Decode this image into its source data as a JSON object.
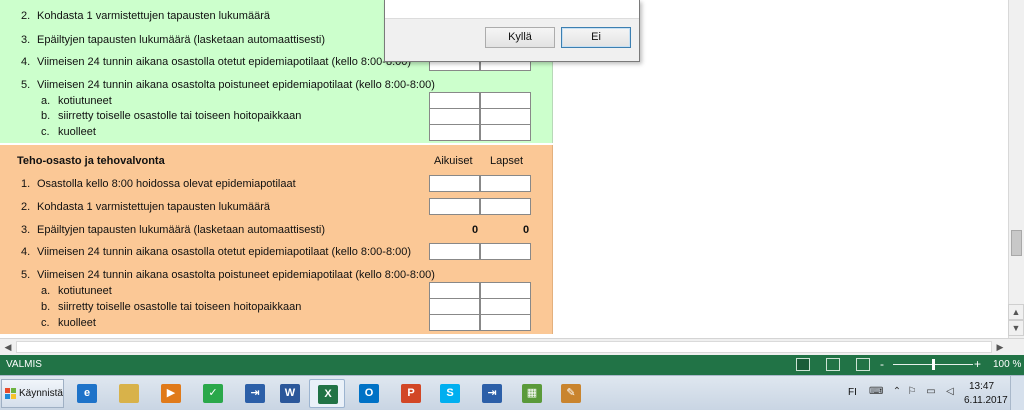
{
  "sheet": {
    "green": {
      "rows": [
        {
          "num": "2.",
          "text": "Kohdasta 1 varmistettujen tapausten lukumäärä"
        },
        {
          "num": "3.",
          "text": "Epäiltyjen tapausten lukumäärä (lasketaan automaattisesti)"
        },
        {
          "num": "4.",
          "text": "Viimeisen 24 tunnin aikana osastolla otetut epidemiapotilaat (kello 8:00-8:00)"
        },
        {
          "num": "5.",
          "text": "Viimeisen 24 tunnin aikana osastolta poistuneet epidemiapotilaat (kello 8:00-8:00)"
        }
      ],
      "sub": [
        {
          "letter": "a.",
          "text": "kotiutuneet"
        },
        {
          "letter": "b.",
          "text": "siirretty toiselle osastolle tai toiseen hoitopaikkaan"
        },
        {
          "letter": "c.",
          "text": "kuolleet"
        }
      ]
    },
    "orange": {
      "title": "Teho-osasto ja tehovalvonta",
      "col_adults": "Aikuiset",
      "col_children": "Lapset",
      "rows": [
        {
          "num": "1.",
          "text": "Osastolla kello 8:00 hoidossa olevat epidemiapotilaat"
        },
        {
          "num": "2.",
          "text": "Kohdasta 1 varmistettujen tapausten lukumäärä"
        },
        {
          "num": "3.",
          "text": "Epäiltyjen tapausten lukumäärä (lasketaan automaattisesti)"
        },
        {
          "num": "4.",
          "text": "Viimeisen 24 tunnin aikana osastolla otetut epidemiapotilaat (kello 8:00-8:00)"
        },
        {
          "num": "5.",
          "text": "Viimeisen 24 tunnin aikana osastolta poistuneet epidemiapotilaat (kello 8:00-8:00)"
        }
      ],
      "suspected_adults": "0",
      "suspected_children": "0",
      "sub": [
        {
          "letter": "a.",
          "text": "kotiutuneet"
        },
        {
          "letter": "b.",
          "text": "siirretty toiselle osastolle tai toiseen hoitopaikkaan"
        },
        {
          "letter": "c.",
          "text": "kuolleet"
        }
      ]
    }
  },
  "dialog": {
    "yes_label": "Kyllä",
    "no_label": "Ei"
  },
  "status": {
    "text": "VALMIS",
    "zoom_minus": "-",
    "zoom_plus": "+",
    "zoom_level": "100 %",
    "zoom_fraction": 0.5
  },
  "taskbar": {
    "start_label": "Käynnistä",
    "apps": [
      {
        "icon": "internet-explorer-icon",
        "color": "#1e73c9",
        "glyph": "e"
      },
      {
        "icon": "file-explorer-icon",
        "color": "#d8b24a",
        "glyph": ""
      },
      {
        "icon": "media-player-icon",
        "color": "#e07a1a",
        "glyph": "▶"
      },
      {
        "icon": "checkmark-app-icon",
        "color": "#2aa84a",
        "glyph": "✓"
      },
      {
        "icon": "input-app-icon",
        "color": "#2c5fa8",
        "glyph": "⇥"
      },
      {
        "icon": "word-icon",
        "color": "#2b579a",
        "glyph": "W"
      },
      {
        "icon": "excel-icon",
        "color": "#217346",
        "glyph": "X"
      },
      {
        "icon": "outlook-icon",
        "color": "#0072c6",
        "glyph": "O"
      },
      {
        "icon": "powerpoint-icon",
        "color": "#d24726",
        "glyph": "P"
      },
      {
        "icon": "skype-icon",
        "color": "#00aff0",
        "glyph": "S"
      },
      {
        "icon": "input-app-icon-2",
        "color": "#2c5fa8",
        "glyph": "⇥"
      },
      {
        "icon": "calculator-icon",
        "color": "#5a9a3a",
        "glyph": "▦"
      },
      {
        "icon": "paint-icon",
        "color": "#c9842e",
        "glyph": "✎"
      }
    ],
    "tray_lang": "FI",
    "clock_time": "13:47",
    "clock_date": "6.11.2017"
  }
}
